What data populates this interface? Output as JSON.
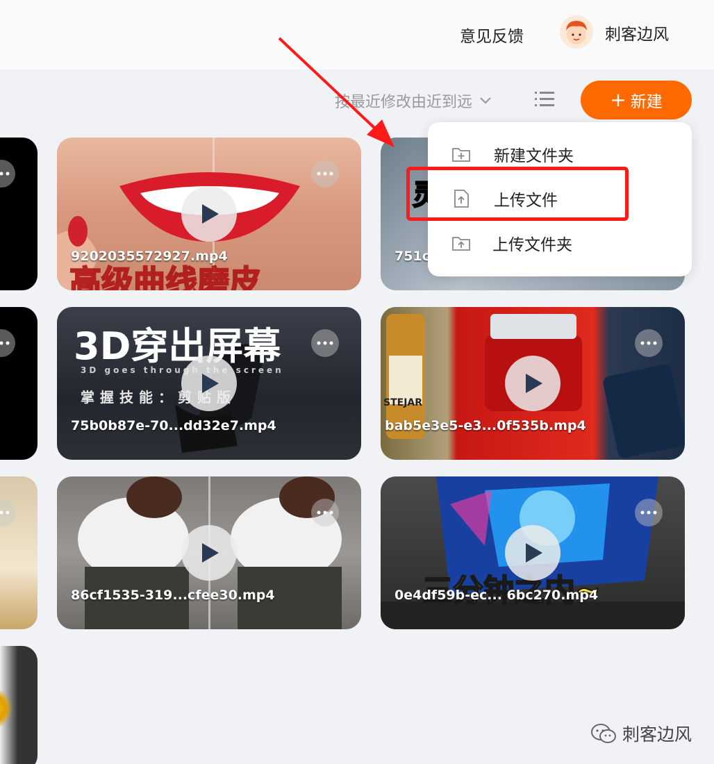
{
  "header": {
    "feedback_label": "意见反馈",
    "username": "刺客边风"
  },
  "toolbar": {
    "sort_label": "按最近修改由近到远",
    "new_button_label": "新建"
  },
  "menu": {
    "items": [
      {
        "label": "新建文件夹",
        "icon": "folder-plus-icon"
      },
      {
        "label": "上传文件",
        "icon": "file-upload-icon"
      },
      {
        "label": "上传文件夹",
        "icon": "folder-upload-icon"
      }
    ]
  },
  "files": [
    {
      "name": "9202035572927.mp4",
      "caption": "高级曲线磨皮"
    },
    {
      "name": "751c",
      "caption": ""
    },
    {
      "name": "75b0b87e-70...dd32e7.mp4",
      "caption": "3D穿出屏幕",
      "sub1": "3D goes through the screen",
      "sub2": "掌握技能：剪贴版"
    },
    {
      "name": "bab5e3e5-e3...0f535b.mp4",
      "caption": "",
      "brand": "STEJAR"
    },
    {
      "name": "86cf1535-319...cfee30.mp4",
      "caption": ""
    },
    {
      "name": "0e4df59b-ec... 6bc270.mp4",
      "caption": "三分钟之内~"
    }
  ],
  "watermark": "刺客边风",
  "colors": {
    "accent": "#ff6a00",
    "highlight": "#ff1a1a",
    "background": "#f1f2f5"
  }
}
